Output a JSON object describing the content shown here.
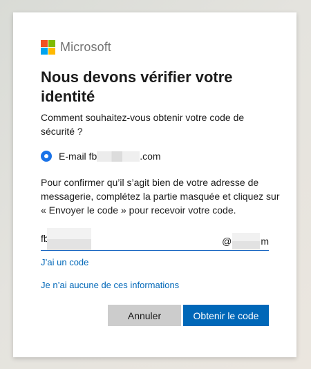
{
  "brand": {
    "name": "Microsoft",
    "logo_colors": [
      "#f25022",
      "#7fba00",
      "#00a4ef",
      "#ffb900"
    ]
  },
  "dialog": {
    "title": "Nous devons vérifier votre identité",
    "question": "Comment souhaitez-vous obtenir votre code de sécurité ?",
    "option": {
      "label_prefix": "E-mail fb",
      "label_suffix": ".com",
      "selected": true
    },
    "explanation": "Pour confirmer qu’il s’agit bien de votre adresse de messagerie, complétez la partie masquée et cliquez sur « Envoyer le code » pour recevoir votre code.",
    "email_input": {
      "prefix": "fb",
      "suffix_start": "@",
      "suffix_end": "m"
    },
    "links": {
      "have_code": "J’ai un code",
      "no_info": "Je n’ai aucune de ces informations"
    },
    "buttons": {
      "cancel": "Annuler",
      "get_code": "Obtenir le code"
    }
  },
  "colors": {
    "accent": "#0067b8",
    "radio": "#1a73e8",
    "cancel_bg": "#cccccc"
  }
}
